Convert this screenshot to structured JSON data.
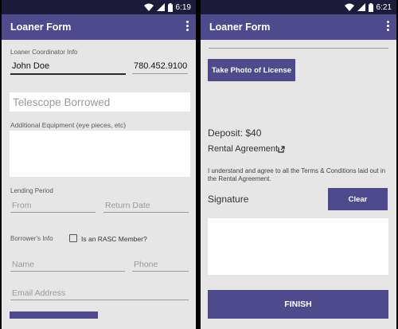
{
  "left": {
    "status": {
      "time": "6:19"
    },
    "app_title": "Loaner Form",
    "coordinator_label": "Loaner Coordinator Info",
    "coordinator_name": "John Doe",
    "coordinator_phone": "780.452.9100",
    "telescope_placeholder": "Telescope Borrowed",
    "equipment_label": "Additional Equipment (eye pieces, etc)",
    "lending_period_label": "Lending Period",
    "from_placeholder": "From",
    "return_placeholder": "Return Date",
    "borrower_label": "Borrower's Info",
    "rasc_checkbox_label": "Is an RASC Member?",
    "name_placeholder": "Name",
    "phone_placeholder": "Phone",
    "email_placeholder": "Email Address"
  },
  "right": {
    "status": {
      "time": "6:21"
    },
    "app_title": "Loaner Form",
    "take_photo_button": "Take Photo of License",
    "deposit_text": "Deposit: $40",
    "rental_agreement_link": "Rental Agreement",
    "terms_text": "I understand and agree to all the Terms & Conditions laid out in the Rental Agreement.",
    "signature_label": "Signature",
    "clear_button": "Clear",
    "finish_button": "FINISH"
  },
  "colors": {
    "primary": "#4f4a8c",
    "status_bar": "#1c1c3a",
    "background": "#e6e6e6"
  },
  "icons": [
    "wifi-icon",
    "cellular-signal-icon",
    "battery-icon",
    "overflow-menu-icon",
    "external-link-icon"
  ]
}
